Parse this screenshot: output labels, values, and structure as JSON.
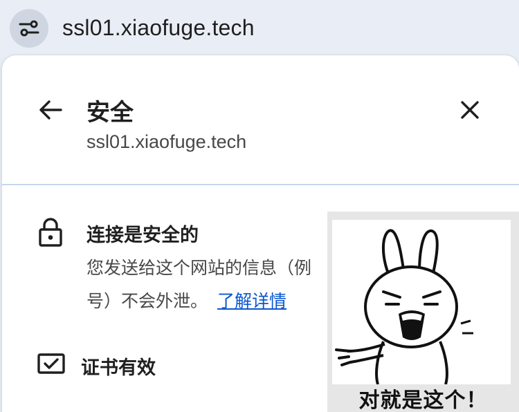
{
  "omnibox": {
    "url": "ssl01.xiaofuge.tech",
    "site_info_icon": "tune-icon"
  },
  "panel": {
    "back_icon": "arrow-back-icon",
    "title": "安全",
    "subtitle": "ssl01.xiaofuge.tech",
    "close_icon": "close-icon",
    "connection": {
      "icon": "lock-icon",
      "title": "连接是安全的",
      "desc_line1": "您发送给这个网站的信息（例",
      "desc_line2": "号）不会外泄。",
      "learn_more": "了解详情"
    },
    "certificate": {
      "icon": "certificate-icon",
      "label": "证书有效"
    }
  },
  "meme": {
    "caption": "对就是这个！"
  },
  "colors": {
    "toolbar_bg": "#e9eef6",
    "link": "#0b57d0",
    "divider": "#c6d6ee",
    "text_primary": "#1f1f1f",
    "text_secondary": "#474747"
  }
}
